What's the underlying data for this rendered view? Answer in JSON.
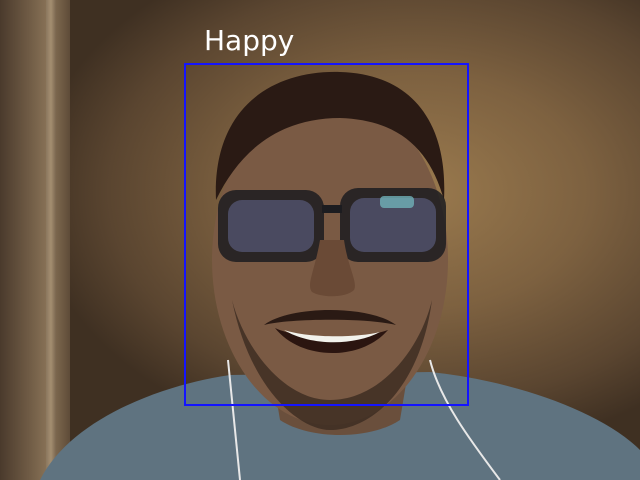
{
  "detection": {
    "label": "Happy",
    "box_color": "#1414ff",
    "label_color": "#ffffff"
  }
}
